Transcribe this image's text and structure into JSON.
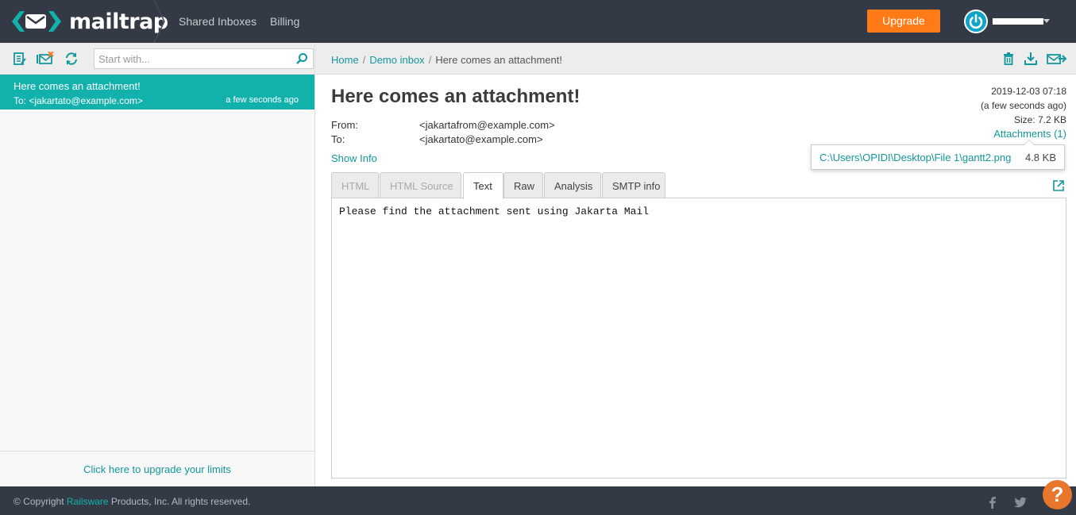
{
  "brand": {
    "name": "mailtrap",
    "accent": "#12b1ac",
    "upgrade_color": "#ff7b17"
  },
  "nav": {
    "shared_inboxes": "Shared Inboxes",
    "billing": "Billing",
    "upgrade": "Upgrade"
  },
  "search": {
    "placeholder": "Start with..."
  },
  "message_list": [
    {
      "subject": "Here comes an attachment!",
      "to": "To: <jakartato@example.com>",
      "time": "a few seconds ago"
    }
  ],
  "upgrade_limits": "Click here to upgrade your limits",
  "breadcrumb": {
    "home": "Home",
    "inbox": "Demo inbox",
    "current": "Here comes an attachment!"
  },
  "message": {
    "subject": "Here comes an attachment!",
    "from_label": "From:",
    "from_value": "<jakartafrom@example.com>",
    "to_label": "To:",
    "to_value": "<jakartato@example.com>",
    "show_info": "Show Info",
    "date": "2019-12-03 07:18",
    "relative_time": "(a few seconds ago)",
    "size": "Size: 7.2 KB",
    "attachments_link": "Attachments (1)",
    "attachment": {
      "name": "C:\\Users\\OPIDI\\Desktop\\File 1\\gantt2.png",
      "size": "4.8 KB"
    },
    "body": "Please find the attachment sent using Jakarta Mail"
  },
  "tabs": [
    "HTML",
    "HTML Source",
    "Text",
    "Raw",
    "Analysis",
    "SMTP info"
  ],
  "footer": {
    "copyright_prefix": "© Copyright",
    "company": "Railsware",
    "copyright_suffix": "Products, Inc. All rights reserved."
  },
  "help": "?"
}
